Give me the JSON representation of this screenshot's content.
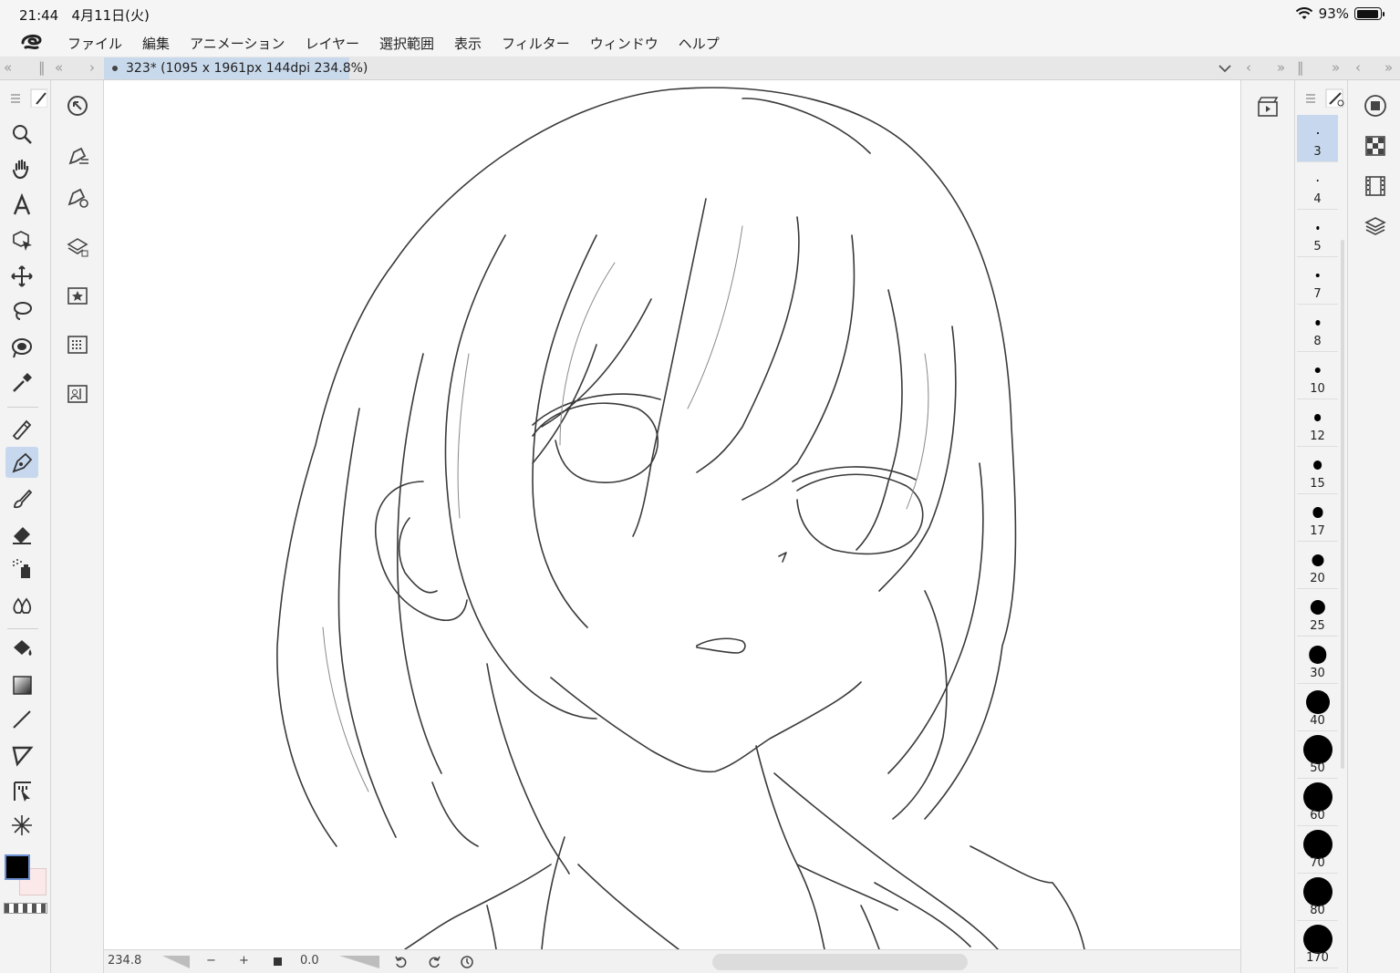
{
  "status_bar": {
    "time": "21:44",
    "date": "4月11日(火)",
    "battery": "93%",
    "battery_level": 0.93
  },
  "menu": {
    "items": [
      "ファイル",
      "編集",
      "アニメーション",
      "レイヤー",
      "選択範囲",
      "表示",
      "フィルター",
      "ウィンドウ",
      "ヘルプ"
    ]
  },
  "tabs": {
    "document_title": "323* (1095 x 1961px 144dpi 234.8%)"
  },
  "tools": [
    {
      "name": "zoom-icon"
    },
    {
      "name": "hand-icon"
    },
    {
      "name": "text-icon"
    },
    {
      "name": "object-select-icon"
    },
    {
      "name": "move-icon"
    },
    {
      "name": "lasso-icon"
    },
    {
      "name": "auto-select-icon"
    },
    {
      "name": "eyedropper-icon"
    },
    {
      "name": "pencil-icon"
    },
    {
      "name": "pen-icon",
      "active": true
    },
    {
      "name": "brush-icon"
    },
    {
      "name": "eraser-icon"
    },
    {
      "name": "airbrush-icon"
    },
    {
      "name": "blend-icon"
    },
    {
      "name": "fill-icon"
    },
    {
      "name": "gradient-icon"
    },
    {
      "name": "line-icon"
    },
    {
      "name": "frame-icon"
    },
    {
      "name": "ruler-icon"
    },
    {
      "name": "effect-line-icon"
    }
  ],
  "colors": {
    "main": "#000000",
    "sub": "#fbe9e9",
    "accent": "#c7d8ee"
  },
  "bottom_bar": {
    "zoom": "234.8",
    "minus": "−",
    "plus": "+",
    "rotation": "0.0"
  },
  "brush_sizes": [
    {
      "label": "3",
      "active": true
    },
    {
      "label": "4"
    },
    {
      "label": "5"
    },
    {
      "label": "7"
    },
    {
      "label": "8"
    },
    {
      "label": "10"
    },
    {
      "label": "12"
    },
    {
      "label": "15"
    },
    {
      "label": "17"
    },
    {
      "label": "20"
    },
    {
      "label": "25"
    },
    {
      "label": "30"
    },
    {
      "label": "40"
    },
    {
      "label": "50"
    },
    {
      "label": "60"
    },
    {
      "label": "70"
    },
    {
      "label": "80"
    },
    {
      "label": "170"
    }
  ]
}
